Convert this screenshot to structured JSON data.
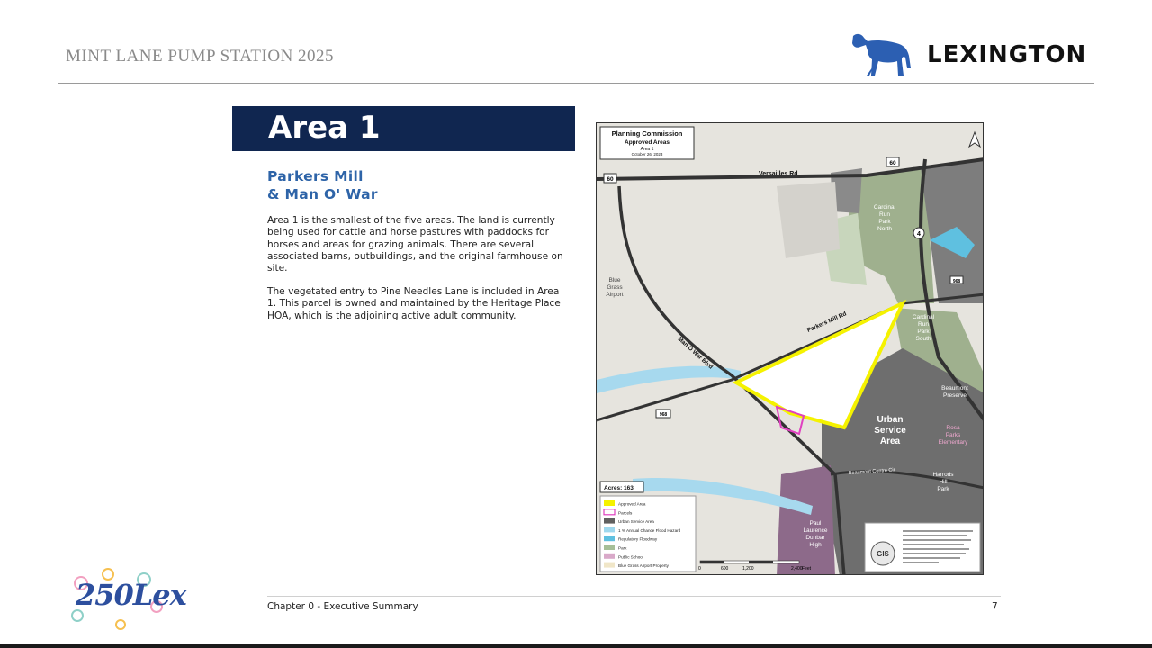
{
  "header": {
    "title": "MINT LANE PUMP STATION 2025",
    "logo_text": "LEXINGTON"
  },
  "section": {
    "banner": "Area 1",
    "subtitle_line1": "Parkers Mill",
    "subtitle_line2": "& Man O' War",
    "paragraph1": "Area 1 is the smallest of the five areas. The land is currently being used for cattle and horse pastures with paddocks for horses and areas for grazing animals. There are several associated barns, outbuildings, and the original farmhouse on site.",
    "paragraph2": "The vegetated entry to Pine Needles Lane is included in Area 1. This parcel is owned and maintained by the Heritage Place HOA, which is the adjoining active adult community."
  },
  "map": {
    "title_line1": "Planning Commission",
    "title_line2": "Approved Areas",
    "title_line3": "Area 1",
    "title_date": "October 26, 2023",
    "roads": {
      "versailles": "Versailles Rd",
      "parkers_mill": "Parkers Mill Rd",
      "man_o_war": "Man O War Blvd",
      "beaumont": "Beaumont Centre Cir"
    },
    "route_shields": [
      "60",
      "60",
      "4",
      "968",
      "968"
    ],
    "labels": {
      "cardinal_north_1": "Cardinal",
      "cardinal_north_2": "Run",
      "cardinal_north_3": "Park",
      "cardinal_north_4": "North",
      "cardinal_south_1": "Cardinal",
      "cardinal_south_2": "Run",
      "cardinal_south_3": "Park",
      "cardinal_south_4": "South",
      "bluegrass_1": "Blue",
      "bluegrass_2": "Grass",
      "bluegrass_3": "Airport",
      "beaumont_1": "Beaumont",
      "beaumont_2": "Preserve",
      "rosa_1": "Rosa",
      "rosa_2": "Parks",
      "rosa_3": "Elementary",
      "usa_1": "Urban",
      "usa_2": "Service",
      "usa_3": "Area",
      "harrods_1": "Harrods",
      "harrods_2": "Hill",
      "harrods_3": "Park",
      "paul_1": "Paul",
      "paul_2": "Laurence",
      "paul_3": "Dunbar",
      "paul_4": "High"
    },
    "acres": "Acres: 163",
    "legend": [
      "Approved Area",
      "Parcels",
      "Urban Service Area",
      "1 % Annual Chance Flood Hazard",
      "Regulatory Floodway",
      "Park",
      "Public School",
      "Blue Grass Airport Property"
    ],
    "legend_colors": [
      "#f5f200",
      "#e040c0",
      "#606060",
      "#9fd8ee",
      "#5fc0e0",
      "#a6bf98",
      "#d9a9c9",
      "#f0e6c8"
    ],
    "scale": [
      "0",
      "600",
      "1,200",
      "2,400",
      "Feet"
    ],
    "gis_label": "GIS"
  },
  "footer": {
    "chapter": "Chapter 0 - Executive Summary",
    "page": "7",
    "brand": "250Lex"
  }
}
